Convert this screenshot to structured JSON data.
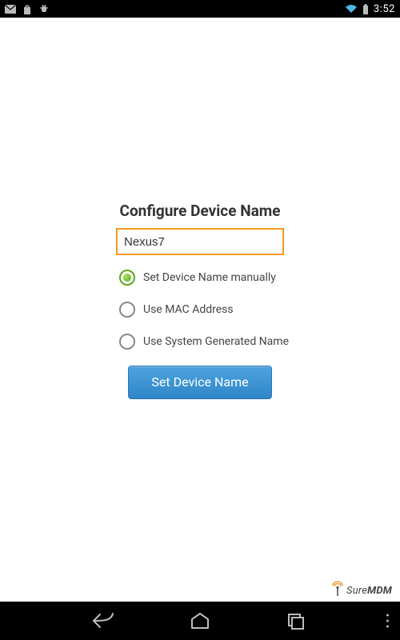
{
  "status_bar": {
    "time": "3:52"
  },
  "form": {
    "title": "Configure Device Name",
    "input_value": "Nexus7",
    "options": [
      {
        "label": "Set Device Name manually",
        "selected": true
      },
      {
        "label": "Use MAC Address",
        "selected": false
      },
      {
        "label": "Use System Generated Name",
        "selected": false
      }
    ],
    "button_label": "Set Device Name"
  },
  "brand": {
    "name_prefix": "Sure",
    "name_suffix": "MDM"
  }
}
